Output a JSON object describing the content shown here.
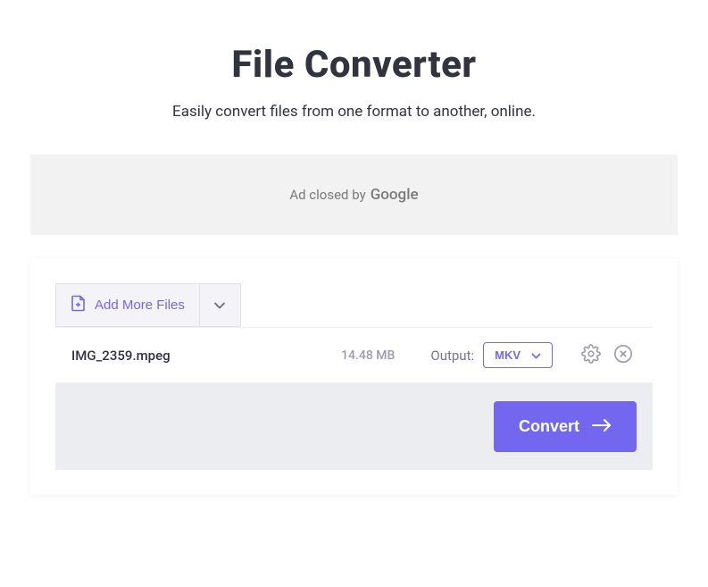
{
  "header": {
    "title": "File Converter",
    "subtitle": "Easily convert files from one format to another, online."
  },
  "ad": {
    "text": "Ad closed by",
    "provider": "Google"
  },
  "toolbar": {
    "add_more_label": "Add More Files"
  },
  "file": {
    "name": "IMG_2359.mpeg",
    "size": "14.48 MB",
    "output_label": "Output:",
    "format": "MKV"
  },
  "actions": {
    "convert_label": "Convert"
  }
}
